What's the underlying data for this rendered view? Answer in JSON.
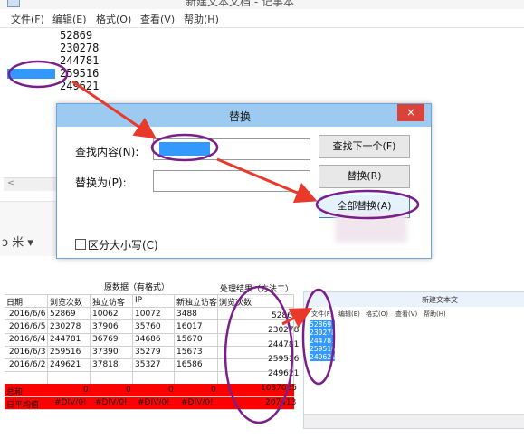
{
  "notepad": {
    "title": "新建文本文档 - 记事本",
    "menu": [
      "文件(F)",
      "编辑(E)",
      "格式(O)",
      "查看(V)",
      "帮助(H)"
    ],
    "lines": [
      "52869",
      "230278",
      "244781",
      "259516",
      "249621"
    ],
    "scroll_left_arrow": "<"
  },
  "toolbar_fragment": {
    "cut_icon_text": "ɔ 米 ▾"
  },
  "dialog": {
    "title": "替换",
    "close_glyph": "×",
    "find_label": "查找内容(N):",
    "find_value": "",
    "replace_label": "替换为(P):",
    "replace_value": "",
    "find_next": "查找下一个(F)",
    "replace": "替换(R)",
    "replace_all": "全部替换(A)",
    "match_case": "区分大小写(C)",
    "match_case_checked": false
  },
  "spreadsheet": {
    "group_header": "原数据（有格式）",
    "result_header": "处理结果（方法二）",
    "columns": [
      "日期",
      "浏览次数",
      "独立访客",
      "IP",
      "新独立访客",
      "浏览次数"
    ],
    "rows": [
      [
        "2016/6/6",
        "52869",
        "10062",
        "10072",
        "3488",
        "52869"
      ],
      [
        "2016/6/5",
        "230278",
        "37906",
        "35760",
        "16017",
        "230278"
      ],
      [
        "2016/6/4",
        "244781",
        "36769",
        "34686",
        "15670",
        "244781"
      ],
      [
        "2016/6/3",
        "259516",
        "37390",
        "35279",
        "15673",
        "259516"
      ],
      [
        "2016/6/2",
        "249621",
        "37818",
        "35327",
        "16586",
        "249621"
      ]
    ],
    "total_row": [
      "总和",
      "0",
      "0",
      "0",
      "0",
      "1037065"
    ],
    "avg_row": [
      "日平均值",
      "#DIV/0!",
      "#DIV/0!",
      "#DIV/0!",
      "#DIV/0!",
      "207413"
    ]
  },
  "notepad2": {
    "title": "新建文本文",
    "menu": [
      "文件(F)",
      "编辑(E)",
      "格式(O)",
      "查看(V)",
      "帮助(H)"
    ],
    "lines": [
      "52869",
      "230278",
      "244781",
      "259516",
      "249621"
    ]
  },
  "colors": {
    "selection": "#3399ff",
    "annotation_circle": "#7a1f8a",
    "arrow": "#e8392b",
    "dialog_title": "#9ccaf0",
    "close_button": "#d9433a",
    "red_rows": "#ff0000"
  }
}
